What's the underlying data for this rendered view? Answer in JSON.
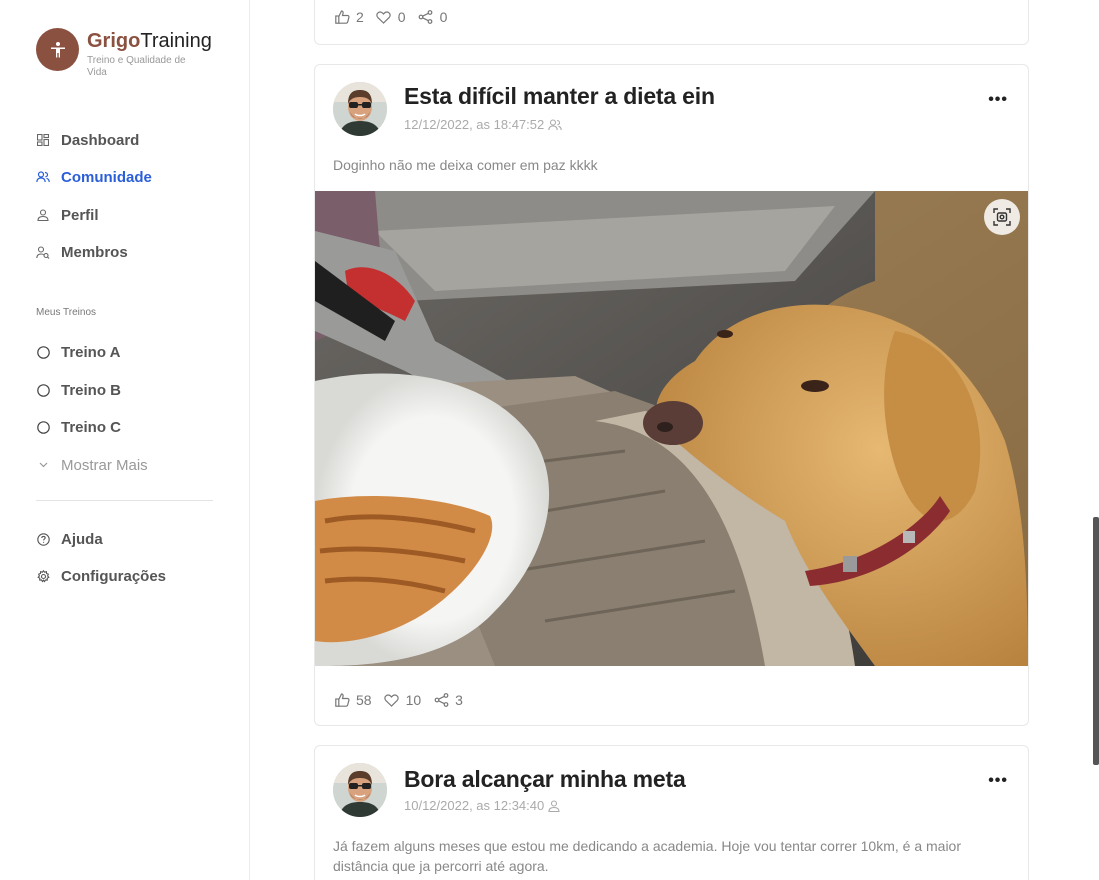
{
  "brand": {
    "name_accent": "Grigo",
    "name_rest": "Training",
    "subtitle": "Treino e Qualidade de Vida"
  },
  "nav": {
    "items": [
      {
        "label": "Dashboard"
      },
      {
        "label": "Comunidade"
      },
      {
        "label": "Perfil"
      },
      {
        "label": "Membros"
      }
    ]
  },
  "workouts": {
    "section_title": "Meus Treinos",
    "items": [
      {
        "label": "Treino A"
      },
      {
        "label": "Treino B"
      },
      {
        "label": "Treino C"
      }
    ],
    "show_more": "Mostrar Mais"
  },
  "footer_nav": {
    "help": "Ajuda",
    "settings": "Configurações"
  },
  "posts": [
    {
      "likes": "2",
      "hearts": "0",
      "shares": "0"
    },
    {
      "title": "Esta difícil manter a dieta ein",
      "timestamp": "12/12/2022, as 18:47:52",
      "audience_icon": "group-icon",
      "text": "Doginho não me deixa comer em paz kkkk",
      "likes": "58",
      "hearts": "10",
      "shares": "3"
    },
    {
      "title": "Bora alcançar minha meta",
      "timestamp": "10/12/2022, as 12:34:40",
      "audience_icon": "user-icon",
      "text": "Já fazem alguns meses que estou me dedicando a academia. Hoje vou tentar correr 10km, é a maior distância que ja percorri até agora."
    }
  ],
  "colors": {
    "brand": "#8b5140",
    "active": "#2b5fd9"
  }
}
